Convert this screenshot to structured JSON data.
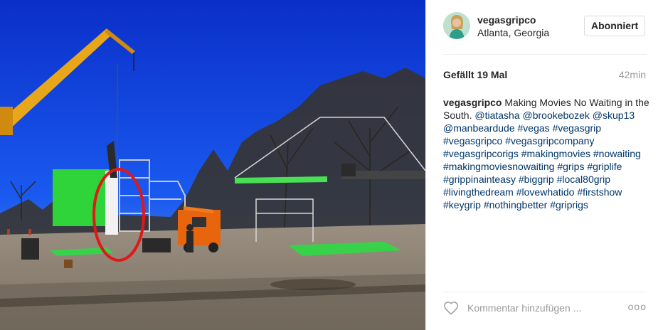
{
  "post": {
    "image_alt": "",
    "user": {
      "username": "vegasgripco",
      "location": "Atlanta, Georgia",
      "follow_label": "Abonniert"
    },
    "likes": "Gefällt 19 Mal",
    "time_ago": "42min",
    "caption": {
      "username": "vegasgripco",
      "text": "Making Movies No Waiting in the South.",
      "mentions": [
        "@tiatasha",
        "@brookebozek",
        "@skup13",
        "@manbeardude"
      ],
      "hashtags": [
        "#vegas",
        "#vegasgrip",
        "#vegasgripco",
        "#vegasgripcompany",
        "#vegasgripcorigs",
        "#makingmovies",
        "#nowaiting",
        "#makingmoviesnowaiting",
        "#grips",
        "#griplife",
        "#grippinainteasy",
        "#biggrip",
        "#local80grip",
        "#livingthedream",
        "#lovewhatido",
        "#firstshow",
        "#keygrip",
        "#nothingbetter",
        "#griprigs"
      ]
    },
    "comment": {
      "placeholder": "Kommentar hinzufügen ...",
      "more_label": "ooo"
    }
  },
  "colors": {
    "sky": "#0b3fd6",
    "green_screen": "#2fd43a",
    "crane": "#e8a61b",
    "highlight_circle": "#e01818",
    "link": "#003569"
  }
}
